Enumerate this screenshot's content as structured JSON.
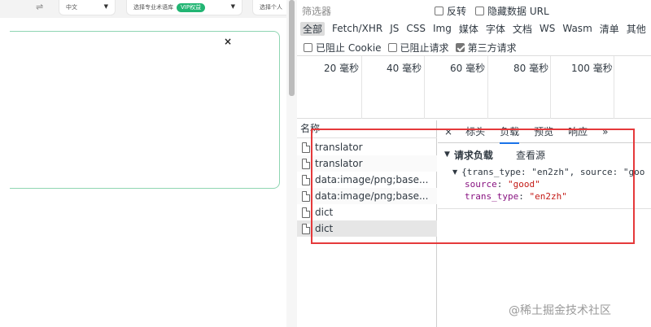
{
  "page": {
    "language_select": "中文",
    "pro_select": "选择专业术语库",
    "vip_badge": "VIP权益",
    "third_select": "选择个人",
    "close_label": "×"
  },
  "devtools": {
    "filter_label": "筛选器",
    "invert_label": "反转",
    "hide_data_url_label": "隐藏数据 URL",
    "type_filters": [
      "全部",
      "Fetch/XHR",
      "JS",
      "CSS",
      "Img",
      "媒体",
      "字体",
      "文档",
      "WS",
      "Wasm",
      "清单",
      "其他"
    ],
    "blocked_cookie_label": "已阻止 Cookie",
    "blocked_requests_label": "已阻止请求",
    "third_party_label": "第三方请求",
    "timeline_ticks": [
      "20 毫秒",
      "40 毫秒",
      "60 毫秒",
      "80 毫秒",
      "100 毫秒"
    ],
    "name_header": "名称",
    "requests": [
      "translator",
      "translator",
      "data:image/png;base...",
      "data:image/png;base...",
      "dict",
      "dict"
    ],
    "tabs": {
      "close": "×",
      "headers": "标头",
      "payload": "负载",
      "preview": "预览",
      "response": "响应",
      "more": "»"
    },
    "payload": {
      "section_title": "请求负载",
      "view_source": "查看源",
      "summary": "{trans_type: \"en2zh\", source: \"goo",
      "source_key": "source",
      "source_value": "\"good\"",
      "type_key": "trans_type",
      "type_value": "\"en2zh\""
    }
  },
  "watermark": "@稀土掘金技术社区",
  "colors": {
    "highlight_border": "#e5393b",
    "active_tab": "#1a73e8",
    "key_color": "#881280",
    "string_color": "#c41a16"
  }
}
